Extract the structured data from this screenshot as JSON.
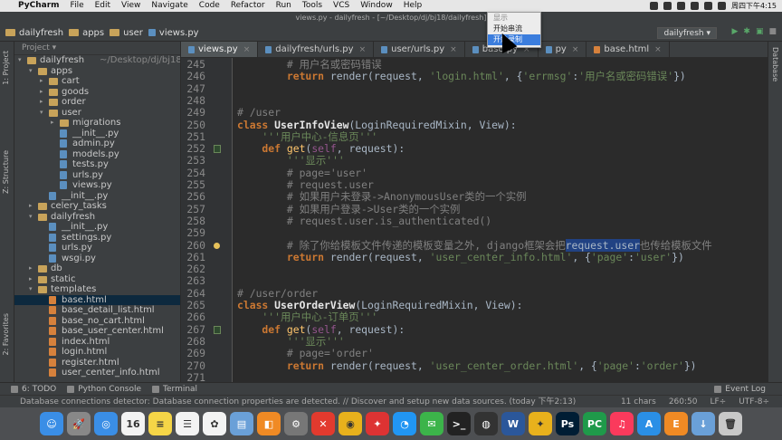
{
  "menubar": {
    "app": "PyCharm",
    "items": [
      "File",
      "Edit",
      "View",
      "Navigate",
      "Code",
      "Refactor",
      "Run",
      "Tools",
      "VCS",
      "Window",
      "Help"
    ],
    "clock": "周四下午4:15"
  },
  "window_title": "views.py - dailyfresh - [~/Desktop/dj/bj18/dailyfresh]",
  "navbar": {
    "crumbs": [
      "dailyfresh",
      "apps",
      "user",
      "views.py"
    ],
    "run_config": "dailyfresh ▾"
  },
  "popup": {
    "items": [
      "显示",
      "开始串流",
      "开始录制"
    ]
  },
  "project_panel": {
    "title": "Project ▾",
    "tree": [
      {
        "label": "dailyfresh",
        "sub": "~/Desktop/dj/bj18",
        "depth": 0,
        "type": "dir",
        "open": true
      },
      {
        "label": "apps",
        "depth": 1,
        "type": "dir",
        "open": true
      },
      {
        "label": "cart",
        "depth": 2,
        "type": "dir",
        "open": false
      },
      {
        "label": "goods",
        "depth": 2,
        "type": "dir",
        "open": false
      },
      {
        "label": "order",
        "depth": 2,
        "type": "dir",
        "open": false
      },
      {
        "label": "user",
        "depth": 2,
        "type": "dir",
        "open": true
      },
      {
        "label": "migrations",
        "depth": 3,
        "type": "dir",
        "open": false
      },
      {
        "label": "__init__.py",
        "depth": 3,
        "type": "py"
      },
      {
        "label": "admin.py",
        "depth": 3,
        "type": "py"
      },
      {
        "label": "models.py",
        "depth": 3,
        "type": "py"
      },
      {
        "label": "tests.py",
        "depth": 3,
        "type": "py"
      },
      {
        "label": "urls.py",
        "depth": 3,
        "type": "py"
      },
      {
        "label": "views.py",
        "depth": 3,
        "type": "py"
      },
      {
        "label": "__init__.py",
        "depth": 2,
        "type": "py"
      },
      {
        "label": "celery_tasks",
        "depth": 1,
        "type": "dir",
        "open": false
      },
      {
        "label": "dailyfresh",
        "depth": 1,
        "type": "dir",
        "open": true
      },
      {
        "label": "__init__.py",
        "depth": 2,
        "type": "py"
      },
      {
        "label": "settings.py",
        "depth": 2,
        "type": "py"
      },
      {
        "label": "urls.py",
        "depth": 2,
        "type": "py"
      },
      {
        "label": "wsgi.py",
        "depth": 2,
        "type": "py"
      },
      {
        "label": "db",
        "depth": 1,
        "type": "dir",
        "open": false
      },
      {
        "label": "static",
        "depth": 1,
        "type": "dir",
        "open": false
      },
      {
        "label": "templates",
        "depth": 1,
        "type": "dir",
        "open": true
      },
      {
        "label": "base.html",
        "depth": 2,
        "type": "html",
        "selected": true
      },
      {
        "label": "base_detail_list.html",
        "depth": 2,
        "type": "html"
      },
      {
        "label": "base_no_cart.html",
        "depth": 2,
        "type": "html"
      },
      {
        "label": "base_user_center.html",
        "depth": 2,
        "type": "html"
      },
      {
        "label": "index.html",
        "depth": 2,
        "type": "html"
      },
      {
        "label": "login.html",
        "depth": 2,
        "type": "html"
      },
      {
        "label": "register.html",
        "depth": 2,
        "type": "html"
      },
      {
        "label": "user_center_info.html",
        "depth": 2,
        "type": "html"
      }
    ]
  },
  "tabs": [
    {
      "label": "views.py",
      "type": "py",
      "active": true
    },
    {
      "label": "dailyfresh/urls.py",
      "type": "py"
    },
    {
      "label": "user/urls.py",
      "type": "py"
    },
    {
      "label": "base.py",
      "type": "py"
    },
    {
      "label": "py",
      "type": "py"
    },
    {
      "label": "base.html",
      "type": "html"
    }
  ],
  "left_strip": [
    "1: Project",
    "Z: Structure",
    "2: Favorites"
  ],
  "right_strip": [
    "Database"
  ],
  "code_lines": [
    {
      "n": "245",
      "tokens": [
        [
          "c",
          "        # 用户名或密码错误"
        ]
      ]
    },
    {
      "n": "246",
      "tokens": [
        [
          "k",
          "        return "
        ],
        [
          "p",
          "render(request, "
        ],
        [
          "s",
          "'login.html'"
        ],
        [
          "p",
          ", {"
        ],
        [
          "s",
          "'errmsg'"
        ],
        [
          "p",
          ":"
        ],
        [
          "s",
          "'用户名或密码错误'"
        ],
        [
          "p",
          "})"
        ]
      ]
    },
    {
      "n": "247",
      "tokens": []
    },
    {
      "n": "248",
      "tokens": []
    },
    {
      "n": "249",
      "tokens": [
        [
          "c",
          "# /user"
        ]
      ]
    },
    {
      "n": "250",
      "tokens": [
        [
          "k",
          "class "
        ],
        [
          "cls",
          "UserInfoView"
        ],
        [
          "p",
          "(LoginRequiredMixin, View):"
        ]
      ]
    },
    {
      "n": "251",
      "tokens": [
        [
          "s",
          "    '''用户中心-信息页'''"
        ]
      ]
    },
    {
      "n": "252",
      "tokens": [
        [
          "k",
          "    def "
        ],
        [
          "fn",
          "get"
        ],
        [
          "p",
          "("
        ],
        [
          "slf",
          "self"
        ],
        [
          "p",
          ", request):"
        ]
      ],
      "mark": "ov"
    },
    {
      "n": "253",
      "tokens": [
        [
          "s",
          "        '''显示'''"
        ]
      ]
    },
    {
      "n": "254",
      "tokens": [
        [
          "c",
          "        # page='user'"
        ]
      ]
    },
    {
      "n": "255",
      "tokens": [
        [
          "c",
          "        # request.user"
        ]
      ]
    },
    {
      "n": "256",
      "tokens": [
        [
          "c",
          "        # 如果用户未登录->AnonymousUser类的一个实例"
        ]
      ]
    },
    {
      "n": "257",
      "tokens": [
        [
          "c",
          "        # 如果用户登录->User类的一个实例"
        ]
      ]
    },
    {
      "n": "258",
      "tokens": [
        [
          "c",
          "        # request.user.is_authenticated()"
        ]
      ]
    },
    {
      "n": "259",
      "tokens": []
    },
    {
      "n": "260",
      "tokens": [
        [
          "c",
          "        # 除了你给模板文件传递的模板变量之外, django框架会把"
        ],
        [
          "hl",
          "request.user"
        ],
        [
          "c",
          "也传给模板文件"
        ]
      ],
      "mark": "bulb"
    },
    {
      "n": "261",
      "tokens": [
        [
          "k",
          "        return "
        ],
        [
          "p",
          "render(request, "
        ],
        [
          "s",
          "'user_center_info.html'"
        ],
        [
          "p",
          ", {"
        ],
        [
          "s",
          "'page'"
        ],
        [
          "p",
          ":"
        ],
        [
          "s",
          "'user'"
        ],
        [
          "p",
          "})"
        ]
      ]
    },
    {
      "n": "262",
      "tokens": []
    },
    {
      "n": "263",
      "tokens": []
    },
    {
      "n": "264",
      "tokens": [
        [
          "c",
          "# /user/order"
        ]
      ]
    },
    {
      "n": "265",
      "tokens": [
        [
          "k",
          "class "
        ],
        [
          "cls",
          "UserOrderView"
        ],
        [
          "p",
          "(LoginRequiredMixin, View):"
        ]
      ]
    },
    {
      "n": "266",
      "tokens": [
        [
          "s",
          "    '''用户中心-订单页'''"
        ]
      ]
    },
    {
      "n": "267",
      "tokens": [
        [
          "k",
          "    def "
        ],
        [
          "fn",
          "get"
        ],
        [
          "p",
          "("
        ],
        [
          "slf",
          "self"
        ],
        [
          "p",
          ", request):"
        ]
      ],
      "mark": "ov"
    },
    {
      "n": "268",
      "tokens": [
        [
          "s",
          "        '''显示'''"
        ]
      ]
    },
    {
      "n": "269",
      "tokens": [
        [
          "c",
          "        # page='order'"
        ]
      ]
    },
    {
      "n": "270",
      "tokens": [
        [
          "k",
          "        return "
        ],
        [
          "p",
          "render(request, "
        ],
        [
          "s",
          "'user_center_order.html'"
        ],
        [
          "p",
          ", {"
        ],
        [
          "s",
          "'page'"
        ],
        [
          "p",
          ":"
        ],
        [
          "s",
          "'order'"
        ],
        [
          "p",
          "})"
        ]
      ]
    },
    {
      "n": "271",
      "tokens": []
    }
  ],
  "toolwindows": {
    "todo": "6: TODO",
    "console": "Python Console",
    "terminal": "Terminal",
    "eventlog": "Event Log"
  },
  "status": {
    "message": "Database connections detector: Database connection properties are detected. // Discover and setup new data sources. (today 下午2:13)",
    "chars": "11 chars",
    "pos": "260:50",
    "lf": "LF÷",
    "enc": "UTF-8÷"
  },
  "dock": [
    {
      "name": "finder-icon",
      "color": "#3a8ee6",
      "g": "☺"
    },
    {
      "name": "launchpad-icon",
      "color": "#888",
      "g": "🚀"
    },
    {
      "name": "safari-icon",
      "color": "#3a8ee6",
      "g": "◎"
    },
    {
      "name": "calendar-icon",
      "color": "#f3f3f3",
      "g": "16"
    },
    {
      "name": "notes-icon",
      "color": "#f5d547",
      "g": "≡"
    },
    {
      "name": "reminders-icon",
      "color": "#f3f3f3",
      "g": "☰"
    },
    {
      "name": "photos-icon",
      "color": "#f3f3f3",
      "g": "✿"
    },
    {
      "name": "preview-icon",
      "color": "#6aa0d8",
      "g": "▤"
    },
    {
      "name": "books-icon",
      "color": "#f08a24",
      "g": "◧"
    },
    {
      "name": "settings-icon",
      "color": "#777",
      "g": "⚙"
    },
    {
      "name": "xmind-icon",
      "color": "#e23a2e",
      "g": "✕"
    },
    {
      "name": "chrome-icon",
      "color": "#e8b11c",
      "g": "◉"
    },
    {
      "name": "app-red-icon",
      "color": "#d33",
      "g": "✦"
    },
    {
      "name": "qq-icon",
      "color": "#2196f3",
      "g": "◔"
    },
    {
      "name": "wechat-icon",
      "color": "#3cb44a",
      "g": "✉"
    },
    {
      "name": "terminal-icon",
      "color": "#222",
      "g": ">_"
    },
    {
      "name": "obs-icon",
      "color": "#333",
      "g": "◍"
    },
    {
      "name": "word-icon",
      "color": "#2b579a",
      "g": "W"
    },
    {
      "name": "app-yellow-icon",
      "color": "#e8b11c",
      "g": "✦"
    },
    {
      "name": "photoshop-icon",
      "color": "#001d34",
      "g": "Ps"
    },
    {
      "name": "pycharm-icon",
      "color": "#1f9a4a",
      "g": "PC"
    },
    {
      "name": "music-icon",
      "color": "#fa3a5c",
      "g": "♫"
    },
    {
      "name": "appstore-icon",
      "color": "#2a8fe6",
      "g": "A"
    },
    {
      "name": "app-orange-icon",
      "color": "#f08a24",
      "g": "E"
    },
    {
      "name": "downloads-icon",
      "color": "#6aa0d8",
      "g": "↓"
    },
    {
      "name": "trash-icon",
      "color": "#c8c8c8",
      "g": "🗑"
    }
  ]
}
